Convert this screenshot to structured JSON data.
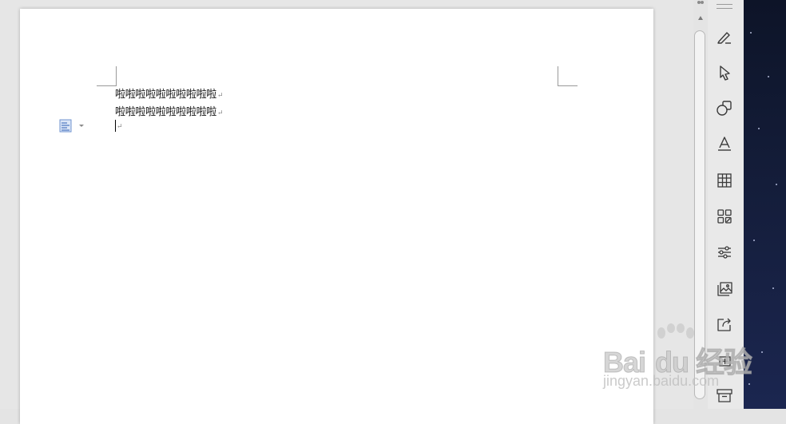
{
  "document": {
    "lines": [
      "啦啦啦啦啦啦啦啦啦啦",
      "啦啦啦啦啦啦啦啦啦啦"
    ],
    "paragraph_mark": "↵"
  },
  "toolbar": {
    "tools": [
      "pen-icon",
      "select-pointer-icon",
      "shapes-icon",
      "text-style-icon",
      "table-icon",
      "apps-icon",
      "adjust-icon",
      "picture-icon",
      "share-icon",
      "zoom-icon",
      "archive-icon"
    ]
  },
  "watermark": {
    "brand": "Bai",
    "brand2": "du",
    "cn": "经验",
    "url": "jingyan.baidu.com"
  },
  "colors": {
    "page": "#ffffff",
    "canvas": "#e6e6e6",
    "toolbar": "#e9e9e9",
    "icon_stroke": "#3a3a3a"
  }
}
